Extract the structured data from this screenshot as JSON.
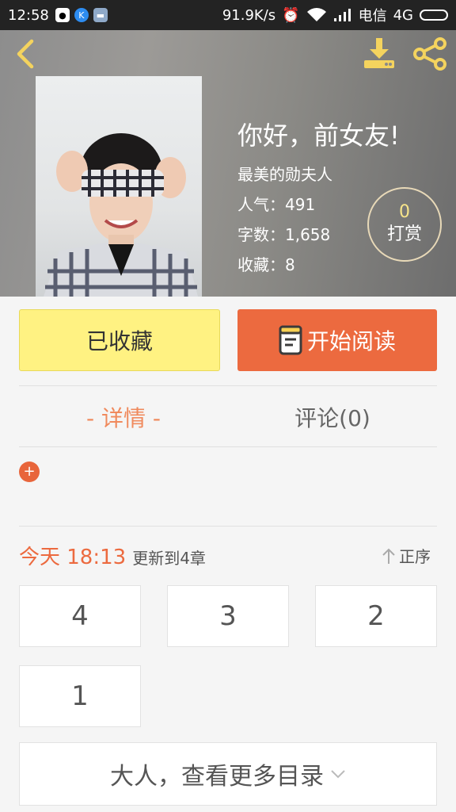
{
  "status_bar": {
    "time": "12:58",
    "net_speed": "91.9K/s",
    "carrier": "电信",
    "network": "4G"
  },
  "header": {
    "back_icon": "chevron-left-icon",
    "download_icon": "download-icon",
    "share_icon": "share-icon"
  },
  "book": {
    "title": "你好，前女友!",
    "author": "最美的勋夫人",
    "popularity": "人气：491",
    "word_count": "字数：1,658",
    "favorites": "收藏：8"
  },
  "reward": {
    "count": "0",
    "label": "打赏"
  },
  "actions": {
    "favorited_label": "已收藏",
    "read_label": "开始阅读"
  },
  "tabs": {
    "detail": "- 详情 -",
    "comments": "评论(0)"
  },
  "update": {
    "date": "今天 18:13",
    "info": "更新到4章",
    "sort_label": "正序"
  },
  "chapters": [
    "4",
    "3",
    "2",
    "1"
  ],
  "more_catalog": "大人，查看更多目录",
  "colors": {
    "accent_orange": "#ec6a3f",
    "fav_yellow": "#fff282",
    "reward_gold": "#f7e48a"
  }
}
